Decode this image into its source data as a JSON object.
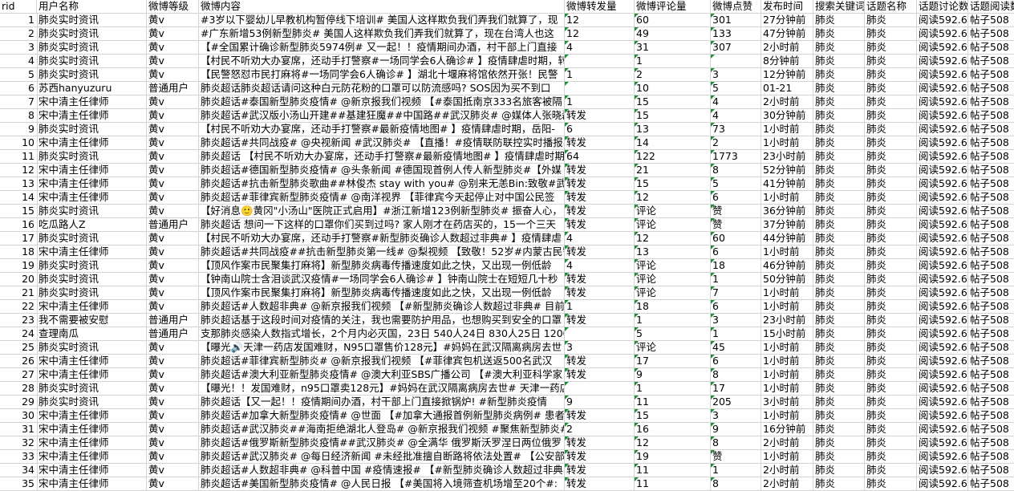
{
  "headers": [
    "rid",
    "用户名称",
    "微博等级",
    "微博内容",
    "微博转发量",
    "微博评论量",
    "微博点赞",
    "发布时间",
    "搜索关键词",
    "话题名称",
    "话题讨论数",
    "话题阅读数"
  ],
  "rows": [
    {
      "rid": "1",
      "user": "肺炎实时资讯",
      "level": "黄v",
      "content": "#3岁以下婴幼儿早教机构暂停线下培训# 美国人这样欺负我们弄我们就算了，现",
      "forward": "12",
      "comment": "60",
      "like": "301",
      "time": "27分钟前",
      "keyword": "肺炎",
      "topic": "肺炎",
      "disc": "阅读592.6亿",
      "read": "帖子508"
    },
    {
      "rid": "2",
      "user": "肺炎实时资讯",
      "level": "黄v",
      "content": "#广东新增53例新型肺炎# 美国人这样欺负我们弄我们就算了，现在台湾人也这",
      "forward": "12",
      "comment": "49",
      "like": "133",
      "time": "47分钟前",
      "keyword": "肺炎",
      "topic": "肺炎",
      "disc": "阅读592.6亿",
      "read": "帖子508"
    },
    {
      "rid": "3",
      "user": "肺炎实时资讯",
      "level": "黄v",
      "content": "【#全国累计确诊新型肺炎5974例# 又一起！！疫情期间办酒，村干部上门直接",
      "forward": "4",
      "comment": "31",
      "like": "307",
      "time": "2小时前",
      "keyword": "肺炎",
      "topic": "肺炎",
      "disc": "阅读592.6亿",
      "read": "帖子508"
    },
    {
      "rid": "4",
      "user": "肺炎实时资讯",
      "level": "黄v",
      "content": "【村民不听劝大办宴席，还动手打警察#一场同学会6人确诊# 】疫情肆虐时期，转发",
      "forward": "",
      "comment": "1",
      "like": "",
      "time": "8分钟前",
      "keyword": "肺炎",
      "topic": "肺炎",
      "disc": "阅读592.6亿",
      "read": "帖子508"
    },
    {
      "rid": "5",
      "user": "肺炎实时资讯",
      "level": "黄v",
      "content": "【民警怒怼市民打麻将#一场同学会6人确诊# 】湖北十堰麻将馆依然开张！民警",
      "forward": "1",
      "comment": "2",
      "like": "3",
      "time": "12分钟前",
      "keyword": "肺炎",
      "topic": "肺炎",
      "disc": "阅读592.6亿",
      "read": "帖子508"
    },
    {
      "rid": "6",
      "user": "苏西hanyuzuru",
      "level": "普通用户",
      "content": "肺炎超话肺炎超话请问这种白元防花粉的口罩可以防流感吗? SOS因为买不到口",
      "forward": "",
      "comment": "10",
      "like": "5",
      "time": "01-21",
      "keyword": "肺炎",
      "topic": "肺炎",
      "disc": "阅读592.6亿",
      "read": "帖子508"
    },
    {
      "rid": "7",
      "user": "宋中清主任律师",
      "level": "黄v",
      "content": "肺炎超话#泰国新型肺炎疫情# @新京报我们视频 【#泰国抵南京333名旅客被隔",
      "forward": "1",
      "comment": "15",
      "like": "4",
      "time": "2小时前",
      "keyword": "肺炎",
      "topic": "肺炎",
      "disc": "阅读592.6亿",
      "read": "帖子508"
    },
    {
      "rid": "8",
      "user": "宋中清主任律师",
      "level": "黄v",
      "content": "肺炎超话#武汉版小汤山开建##基建狂魔##中国路##武汉肺炎# @媒体人张晓磊",
      "forward": "转发",
      "comment": "15",
      "like": "4",
      "time": "30分钟前",
      "keyword": "肺炎",
      "topic": "肺炎",
      "disc": "阅读592.6亿",
      "read": "帖子508"
    },
    {
      "rid": "9",
      "user": "肺炎实时资讯",
      "level": "黄v",
      "content": "【村民不听劝大办宴席，还动手打警察#最新疫情地图# 】疫情肆虐时期，岳阳-",
      "forward": "6",
      "comment": "13",
      "like": "73",
      "time": "1小时前",
      "keyword": "肺炎",
      "topic": "肺炎",
      "disc": "阅读592.6亿",
      "read": "帖子508"
    },
    {
      "rid": "10",
      "user": "宋中清主任律师",
      "level": "黄v",
      "content": "肺炎超话#共同战疫# @央视新闻 #武汉肺炎# 【直播！#疫情联防联控实时播报#",
      "forward": "转发",
      "comment": "14",
      "like": "2",
      "time": "1小时前",
      "keyword": "肺炎",
      "topic": "肺炎",
      "disc": "阅读592.6亿",
      "read": "帖子508"
    },
    {
      "rid": "11",
      "user": "肺炎实时资讯",
      "level": "黄v",
      "content": "肺炎超话 【村民不听劝大办宴席，还动手打警察#最新疫情地图# 】疫情肆虐时期",
      "forward": "64",
      "comment": "122",
      "like": "1773",
      "time": "23小时前",
      "keyword": "肺炎",
      "topic": "肺炎",
      "disc": "阅读592.6亿",
      "read": "帖子508"
    },
    {
      "rid": "12",
      "user": "宋中清主任律师",
      "level": "黄v",
      "content": "肺炎超话#德国新型肺炎疫情# @头条新闻 #德国现首例人传人新型肺炎#【外媒",
      "forward": "转发",
      "comment": "21",
      "like": "8",
      "time": "52分钟前",
      "keyword": "肺炎",
      "topic": "肺炎",
      "disc": "阅读592.6亿",
      "read": "帖子508"
    },
    {
      "rid": "13",
      "user": "宋中清主任律师",
      "level": "黄v",
      "content": "肺炎超话#抗击新型肺炎歌曲##林俊杰 stay with you# @别来无恙Bin:致敬#武汉",
      "forward": "转发",
      "comment": "15",
      "like": "5",
      "time": "41分钟前",
      "keyword": "肺炎",
      "topic": "肺炎",
      "disc": "阅读592.6亿",
      "read": "帖子508"
    },
    {
      "rid": "14",
      "user": "宋中清主任律师",
      "level": "黄v",
      "content": "肺炎超话#菲律宾新型肺炎疫情# @南洋视界 【菲律宾今天起停止对中国公民签",
      "forward": "转发",
      "comment": "12",
      "like": "6",
      "time": "1小时前",
      "keyword": "肺炎",
      "topic": "肺炎",
      "disc": "阅读592.6亿",
      "read": "帖子508"
    },
    {
      "rid": "15",
      "user": "肺炎实时资讯",
      "level": "黄v",
      "content": "【好消息🙂黄冈\"小汤山\"医院正式启用】#浙江新增123例新型肺炎# 振奋人心，",
      "forward": "转发",
      "comment": "评论",
      "like": "赞",
      "time": "36分钟前",
      "keyword": "肺炎",
      "topic": "肺炎",
      "disc": "阅读592.6亿",
      "read": "帖子508"
    },
    {
      "rid": "16",
      "user": "吃瓜路人Z",
      "level": "普通用户",
      "content": "肺炎超话 想问一下这样的口罩你们买到过吗? 家人刚才在药店买的，15一个三天",
      "forward": "转发",
      "comment": "评论",
      "like": "赞",
      "time": "37分钟前",
      "keyword": "肺炎",
      "topic": "肺炎",
      "disc": "阅读592.6亿",
      "read": "帖子508"
    },
    {
      "rid": "17",
      "user": "肺炎实时资讯",
      "level": "黄v",
      "content": "【村民不听劝大办宴席，还动手打警察#新型肺炎确诊人数超过非典# 】疫情肆虐",
      "forward": "4",
      "comment": "12",
      "like": "60",
      "time": "44分钟前",
      "keyword": "肺炎",
      "topic": "肺炎",
      "disc": "阅读592.6亿",
      "read": "帖子508"
    },
    {
      "rid": "18",
      "user": "宋中清主任律师",
      "level": "黄v",
      "content": "肺炎超话#共同战疫##抗击新型肺炎第一线# @梨视频 【致敬！52岁#内蒙古民警",
      "forward": "转发",
      "comment": "13",
      "like": "6",
      "time": "1小时前",
      "keyword": "肺炎",
      "topic": "肺炎",
      "disc": "阅读592.6亿",
      "read": "帖子508"
    },
    {
      "rid": "19",
      "user": "肺炎实时资讯",
      "level": "黄v",
      "content": "【顶风作案市民聚集打麻将】新型肺炎病毒传播速度如此之快，又出现一例低龄",
      "forward": "4",
      "comment": "评论",
      "like": "18",
      "time": "46分钟前",
      "keyword": "肺炎",
      "topic": "肺炎",
      "disc": "阅读592.6亿",
      "read": "帖子508"
    },
    {
      "rid": "20",
      "user": "肺炎实时资讯",
      "level": "黄v",
      "content": "【钟南山院士含泪谈武汉疫情#一场同学会6人确诊# 】钟南山院士在短短几十秒",
      "forward": "转发",
      "comment": "评论",
      "like": "1",
      "time": "50分钟前",
      "keyword": "肺炎",
      "topic": "肺炎",
      "disc": "阅读592.6亿",
      "read": "帖子508"
    },
    {
      "rid": "21",
      "user": "肺炎实时资讯",
      "level": "黄v",
      "content": "【顶风作案市民聚集打麻将】新型肺炎病毒传播速度如此之快，又出现一例低龄",
      "forward": "转发",
      "comment": "评论",
      "like": "7",
      "time": "1小时前",
      "keyword": "肺炎",
      "topic": "肺炎",
      "disc": "阅读592.6亿",
      "read": "帖子508"
    },
    {
      "rid": "22",
      "user": "宋中清主任律师",
      "level": "黄v",
      "content": "肺炎超话#人数超非典# @新京报我们视频 【#新型肺炎确诊人数超过非典# 目前",
      "forward": "1",
      "comment": "18",
      "like": "6",
      "time": "1小时前",
      "keyword": "肺炎",
      "topic": "肺炎",
      "disc": "阅读592.6亿",
      "read": "帖子508"
    },
    {
      "rid": "23",
      "user": "我不需要被安慰",
      "level": "普通用户",
      "content": "肺炎超话基于这段时间对疫情的关注，我也需要防护用品，也想购买到安全的口罩",
      "forward": "转发",
      "comment": "1",
      "like": "3",
      "time": "23小时前",
      "keyword": "肺炎",
      "topic": "肺炎",
      "disc": "阅读592.6亿",
      "read": "帖子508"
    },
    {
      "rid": "24",
      "user": "查理南瓜",
      "level": "普通用户",
      "content": "支那肺炎感染人数指式增长，2个月内必灭国，23日 540人24日 830人25日 1200",
      "forward": "",
      "comment": "5",
      "like": "1",
      "time": "15小时前",
      "keyword": "肺炎",
      "topic": "肺炎",
      "disc": "阅读592.6亿",
      "read": "帖子508"
    },
    {
      "rid": "25",
      "user": "肺炎实时资讯",
      "level": "黄v",
      "content": "【曝光🔊天津一药店发国难财，N95口罩售价128元】#妈妈在武汉隔离病房去世",
      "forward": "3",
      "comment": "评论",
      "like": "45",
      "time": "1小时前",
      "keyword": "肺炎",
      "topic": "肺炎",
      "disc": "阅读592.6亿",
      "read": "帖子508"
    },
    {
      "rid": "26",
      "user": "宋中清主任律师",
      "level": "黄v",
      "content": "肺炎超话#菲律宾新型肺炎# @新京报我们视频 【#菲律宾包机送返500名武汉",
      "forward": "转发",
      "comment": "17",
      "like": "6",
      "time": "1小时前",
      "keyword": "肺炎",
      "topic": "肺炎",
      "disc": "阅读592.6亿",
      "read": "帖子508"
    },
    {
      "rid": "27",
      "user": "宋中清主任律师",
      "level": "黄v",
      "content": "肺炎超话#澳大利亚新型肺炎疫情# @澳大利亚SBS广播公司 【#澳大利亚科学家",
      "forward": "转发",
      "comment": "9",
      "like": "8",
      "time": "1小时前",
      "keyword": "肺炎",
      "topic": "肺炎",
      "disc": "阅读592.6亿",
      "read": "帖子508"
    },
    {
      "rid": "28",
      "user": "肺炎实时资讯",
      "level": "黄v",
      "content": "【曝光！！发国难财，n95口罩卖128元】#妈妈在武汉隔离病房去世# 天津一药店",
      "forward": "",
      "comment": "1",
      "like": "17",
      "time": "1小时前",
      "keyword": "肺炎",
      "topic": "肺炎",
      "disc": "阅读592.6亿",
      "read": "帖子508"
    },
    {
      "rid": "29",
      "user": "肺炎实时资讯",
      "level": "黄v",
      "content": "肺炎超话【又一起！！疫情期间办酒，村干部上门直接掀锅炉! #新型肺炎疫情",
      "forward": "9",
      "comment": "11",
      "like": "205",
      "time": "3小时前",
      "keyword": "肺炎",
      "topic": "肺炎",
      "disc": "阅读592.6亿",
      "read": "帖子508"
    },
    {
      "rid": "30",
      "user": "宋中清主任律师",
      "level": "黄v",
      "content": "肺炎超话#加拿大新型肺炎疫情# @世面 【#加拿大通报首例新型肺炎病例# 患者",
      "forward": "转发",
      "comment": "15",
      "like": "3",
      "time": "1小时前",
      "keyword": "肺炎",
      "topic": "肺炎",
      "disc": "阅读592.6亿",
      "read": "帖子508"
    },
    {
      "rid": "31",
      "user": "宋中清主任律师",
      "level": "黄v",
      "content": "肺炎超话#武汉肺炎##海南拒绝湖北人登岛# @新京报我们视频 #聚焦新型肺炎#",
      "forward": "2",
      "comment": "16",
      "like": "9",
      "time": "16分钟前",
      "keyword": "肺炎",
      "topic": "肺炎",
      "disc": "阅读592.6亿",
      "read": "帖子508"
    },
    {
      "rid": "32",
      "user": "宋中清主任律师",
      "level": "黄v",
      "content": "肺炎超话#俄罗斯新型肺炎疫情##武汉肺炎# @全满华 俄罗斯沃罗涅日两位俄罗",
      "forward": "转发",
      "comment": "12",
      "like": "8",
      "time": "2小时前",
      "keyword": "肺炎",
      "topic": "肺炎",
      "disc": "阅读592.6亿",
      "read": "帖子508"
    },
    {
      "rid": "33",
      "user": "宋中清主任律师",
      "level": "黄v",
      "content": "肺炎超话#武汉肺炎# @每日经济新闻 #未经批准擅自断路将依法处置# 【公安部",
      "forward": "转发",
      "comment": "19",
      "like": "赞",
      "time": "1小时前",
      "keyword": "肺炎",
      "topic": "肺炎",
      "disc": "阅读592.6亿",
      "read": "帖子508"
    },
    {
      "rid": "34",
      "user": "宋中清主任律师",
      "level": "黄v",
      "content": "肺炎超话#人数超非典# @科普中国 #疫情速报# 【#新型肺炎确诊人数超过非典",
      "forward": "转发",
      "comment": "11",
      "like": "1",
      "time": "2小时前",
      "keyword": "肺炎",
      "topic": "肺炎",
      "disc": "阅读592.6亿",
      "read": "帖子508"
    },
    {
      "rid": "35",
      "user": "宋中清主任律师",
      "level": "黄v",
      "content": "肺炎超话#美国新型肺炎疫情# @人民日报 【#美国将入境筛查机场增至20个#:",
      "forward": "转发",
      "comment": "11",
      "like": "8",
      "time": "2小时前",
      "keyword": "肺炎",
      "topic": "肺炎",
      "disc": "阅读592.6亿",
      "read": "帖子508"
    }
  ]
}
